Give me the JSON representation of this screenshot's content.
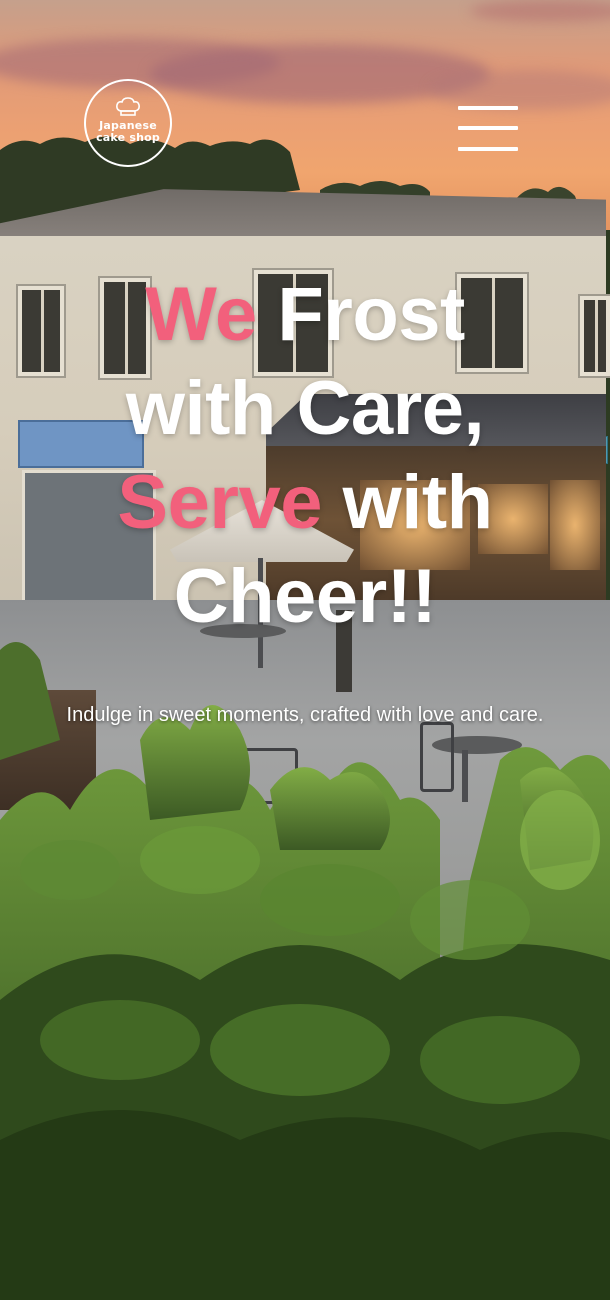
{
  "header": {
    "logo_line1": "Japanese",
    "logo_line2": "cake shop",
    "menu_icon": "hamburger-menu-icon",
    "logo_icon": "chef-hat-icon"
  },
  "hero": {
    "line1_accent": "We",
    "line1_rest": " Frost",
    "line2": "with Care,",
    "line3_accent": "Serve",
    "line3_rest": " with",
    "line4": "Cheer!!",
    "tagline": "Indulge in sweet moments, crafted with love and care."
  },
  "colors": {
    "accent": "#f2607c",
    "text": "#ffffff"
  }
}
